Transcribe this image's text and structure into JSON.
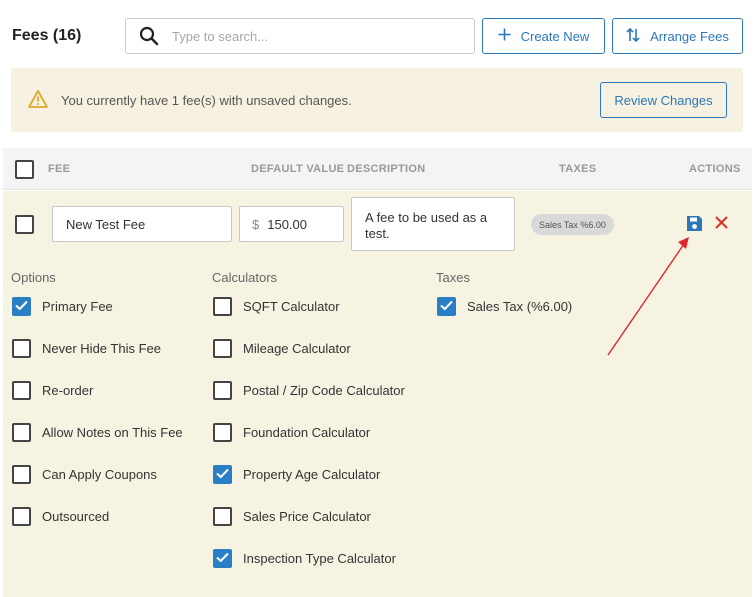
{
  "header": {
    "title": "Fees (16)",
    "search_placeholder": "Type to search...",
    "create_label": "Create New",
    "arrange_label": "Arrange Fees"
  },
  "alert": {
    "message": "You currently have 1 fee(s) with unsaved changes.",
    "review_label": "Review Changes"
  },
  "table": {
    "columns": [
      "FEE",
      "DEFAULT VALUE",
      "DESCRIPTION",
      "TAXES",
      "ACTIONS"
    ]
  },
  "fee": {
    "name": "New Test Fee",
    "currency": "$",
    "value": "150.00",
    "description": "A fee to be used as a test.",
    "tax_badge": "Sales Tax %6.00"
  },
  "groups": {
    "options_label": "Options",
    "calculators_label": "Calculators",
    "taxes_label": "Taxes",
    "options": [
      {
        "label": "Primary Fee",
        "checked": true
      },
      {
        "label": "Never Hide This Fee",
        "checked": false
      },
      {
        "label": "Re-order",
        "checked": false
      },
      {
        "label": "Allow Notes on This Fee",
        "checked": false
      },
      {
        "label": "Can Apply Coupons",
        "checked": false
      },
      {
        "label": "Outsourced",
        "checked": false
      }
    ],
    "calculators": [
      {
        "label": "SQFT Calculator",
        "checked": false
      },
      {
        "label": "Mileage Calculator",
        "checked": false
      },
      {
        "label": "Postal / Zip Code Calculator",
        "checked": false
      },
      {
        "label": "Foundation Calculator",
        "checked": false
      },
      {
        "label": "Property Age Calculator",
        "checked": true
      },
      {
        "label": "Sales Price Calculator",
        "checked": false
      },
      {
        "label": "Inspection Type Calculator",
        "checked": true
      }
    ],
    "taxes": [
      {
        "label": "Sales Tax (%6.00)",
        "checked": true
      }
    ]
  },
  "icons": {
    "search": "search-icon",
    "plus": "plus-icon",
    "arrange": "sort-arrows-icon",
    "warning": "warning-icon",
    "save": "save-icon",
    "delete": "close-icon",
    "check": "checkmark-icon"
  },
  "colors": {
    "accent": "#2a78b8",
    "checked": "#2a7ec6",
    "alert_bg": "#f6f1e1",
    "panel_bg": "#f7f3e3",
    "warning": "#e0a92b",
    "delete": "#d9342b",
    "annotation_arrow": "#e0262a"
  }
}
